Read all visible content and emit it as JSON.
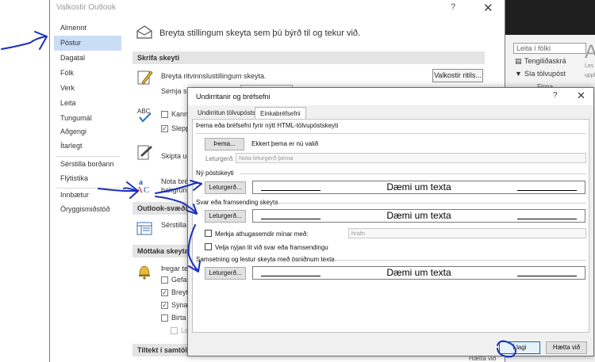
{
  "outlook_options": {
    "title": "Valkostir Outlook",
    "help": "?",
    "close": "✕",
    "nav": [
      "Almennt",
      "Póstur",
      "Dagatal",
      "Fólk",
      "Verk",
      "Leita",
      "Tungumál",
      "Aðgengi",
      "Ítarlegt",
      "Sérstilla borðann",
      "Flýtistika",
      "Innbætur",
      "Öryggismiðstöð"
    ],
    "nav_active_index": 1,
    "heading": "Breyta stillingum skeyta sem þú býrð til og tekur við.",
    "sections": {
      "compose": "Skrifa skeyti",
      "outlook_panes": "Outlook-svæði",
      "receive": "Móttaka skeyta",
      "conversation": "Tiltekt í samtölum"
    },
    "compose": {
      "edit_settings_text": "Breyta ritvinnslustillingum skeyta.",
      "compose_prefix": "Semja skeyti",
      "editor_options_button": "Valkostir ritils...",
      "check_label_1": "Kanna",
      "check_label_2": "Sleppa",
      "signature_prefix": "Skipta um",
      "stationery_prefix_1": "Nota bréf",
      "stationery_prefix_2": "bakgrunn"
    },
    "panes": {
      "customize_prefix": "Sérstilla"
    },
    "receive": {
      "when_prefix": "Þegar tek",
      "opt_1": "Gefa h",
      "opt_2": "Breyta",
      "opt_3": "Sýna u",
      "opt_4": "Birta s",
      "opt_5": "Les"
    }
  },
  "ribbon": {
    "search_people": "Leita í fólki",
    "address_book": "Tengiliðaskrá",
    "filter_mail": "Sía tölvupóst",
    "find": "Finna",
    "partial_letter": "A",
    "partial_upp": "Les",
    "partial_ups": "upph",
    "bottom_reply": "Hætta við"
  },
  "signature_dialog": {
    "title": "Undirritanir og bréfsefni",
    "help": "?",
    "close": "✕",
    "tabs": [
      "Undirritun tölvupósts",
      "Einkabréfsefni"
    ],
    "active_tab": 1,
    "theme_group": "Þema eða bréfsefni fyrir nýtt HTML-tölvupóstskeyti",
    "theme_button": "Þema...",
    "no_theme": "Ekkert þema er nú valið",
    "font_label": "Leturgerð:",
    "font_value": "Nota leturgerð þema",
    "new_mail_group": "Ný póstskeyti",
    "reply_group": "Svar eða framsending skeyta",
    "plain_group": "Samsetning og lestur skeyta með ósniðnum texta",
    "font_button": "Leturgerð...",
    "sample_text": "Dæmi um texta",
    "mark_comments": "Merkja athugasemdir mínar með:",
    "mark_value": "hrafn",
    "pick_color": "Velja nýjan lit við svar eða framsendingu",
    "ok": "Í lagi",
    "cancel": "Hætta við"
  },
  "colors": {
    "nav_active": "#c9def5",
    "annotation_ink": "#1a2fb8",
    "ok_border": "#0a64c8"
  }
}
